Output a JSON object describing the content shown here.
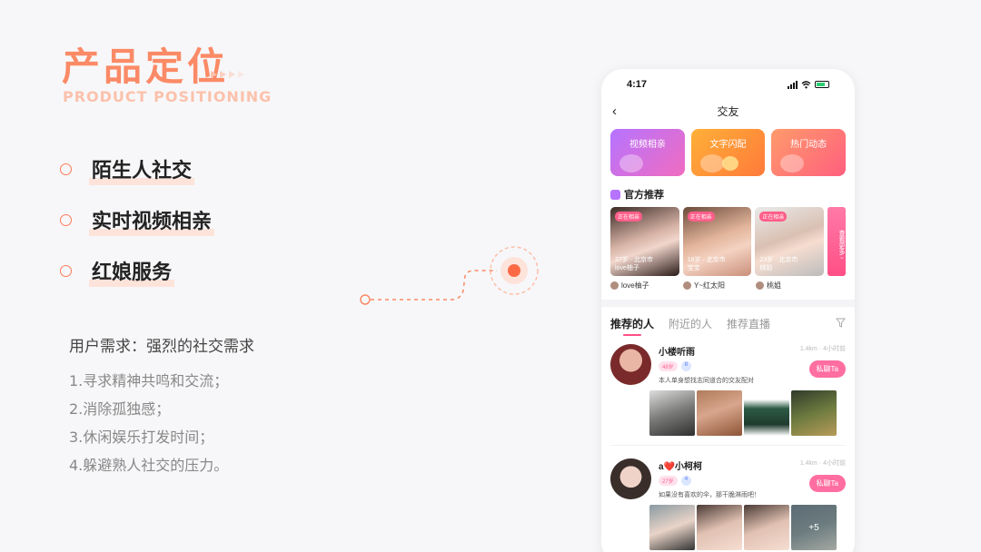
{
  "slide": {
    "title": "产品定位",
    "subtitle": "PRODUCT POSITIONING",
    "bullets": [
      "陌生人社交",
      "实时视频相亲",
      "红娘服务"
    ],
    "needs_title": "用户需求：强烈的社交需求",
    "needs": [
      "1.寻求精神共鸣和交流；",
      "2.消除孤独感；",
      "3.休闲娱乐打发时间；",
      "4.躲避熟人社交的压力。"
    ],
    "accent": "#fb8a66"
  },
  "phone": {
    "time": "4:17",
    "nav_title": "交友",
    "back_glyph": "‹",
    "cards": [
      "视频相亲",
      "文字闪配",
      "热门动态"
    ],
    "official_title": "官方推荐",
    "live_tag": "正在相亲",
    "official": [
      {
        "info1": "37岁 · 北京市",
        "info2": "love柚子",
        "name": "love柚子"
      },
      {
        "info1": "18岁 · 北京市",
        "info2": "宝宝",
        "name": "Y~红太阳"
      },
      {
        "info1": "23岁 · 北京市",
        "info2": "桃姐",
        "name": "桃姐"
      }
    ],
    "more_label": "查看更多 ›",
    "tabs": [
      "推荐的人",
      "附近的人",
      "推荐直播"
    ],
    "people": [
      {
        "name": "小楼听雨",
        "age": "48岁",
        "level": "8",
        "bio": "本人单身想找志同道合的交友配对",
        "meta": "1.4km · 4小时前",
        "chat": "私聊Ta"
      },
      {
        "name": "a❤️小柯柯",
        "age": "27岁",
        "level": "4",
        "bio": "如果没有喜欢的伞，那干脆淋雨吧！",
        "meta": "1.4km · 4小时前",
        "chat": "私聊Ta",
        "more_photos": "+5"
      }
    ]
  }
}
